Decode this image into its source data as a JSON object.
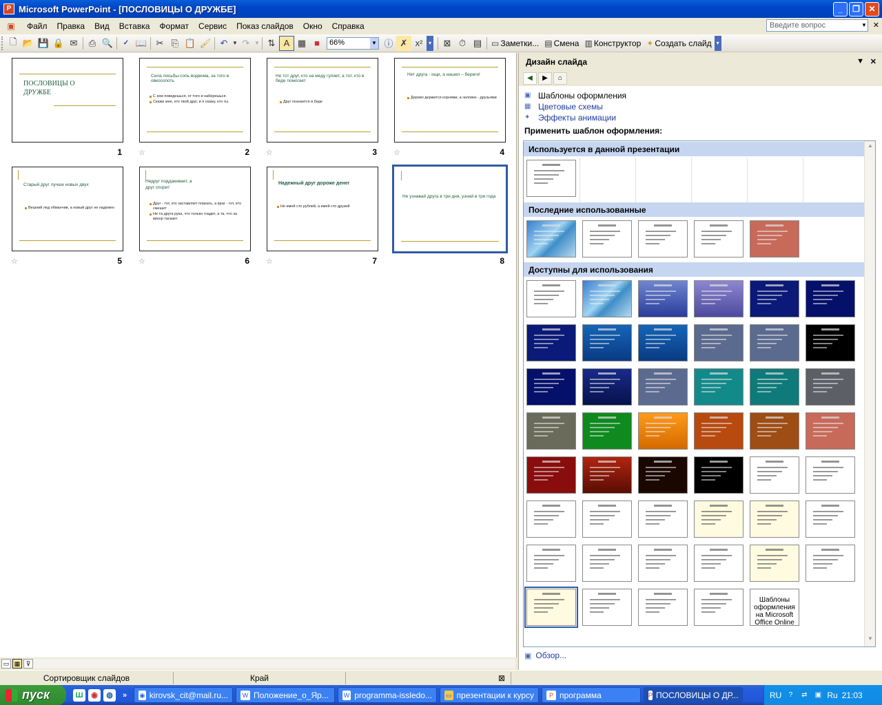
{
  "window": {
    "title": "Microsoft PowerPoint - [ПОСЛОВИЦЫ О ДРУЖБЕ]"
  },
  "menu": [
    "Файл",
    "Правка",
    "Вид",
    "Вставка",
    "Формат",
    "Сервис",
    "Показ слайдов",
    "Окно",
    "Справка"
  ],
  "ask": {
    "placeholder": "Введите вопрос"
  },
  "toolbar": {
    "zoom": "66%",
    "notes": "Заметки...",
    "transition": "Смена",
    "designer": "Конструктор",
    "new_slide": "Создать слайд"
  },
  "slides": [
    {
      "num": "1",
      "title": "ПОСЛОВИЦЫ О ДРУЖБЕ",
      "bullets": []
    },
    {
      "num": "2",
      "title": "Сила лисьбы-сопь водвома, за того в овкосопоть",
      "bullets": [
        "С кем поведешься, от того и наберешься.",
        "Скажи мне, кто твой друг, и я скажу, кто ты."
      ]
    },
    {
      "num": "3",
      "title": "Не тот друг, кто на меду гуляет, а тот, кто в беде помогает",
      "bullets": [
        "Друг познается в беде"
      ]
    },
    {
      "num": "4",
      "title": "Нет друга - ищи, а нашел – береги!",
      "bullets": [
        "Дерево держится корнями, а человек - друзьями"
      ]
    },
    {
      "num": "5",
      "title": "Старый друг лучше новых двух",
      "bullets": [
        "Вешний лед обманчив, а новый друг не надежен"
      ]
    },
    {
      "num": "6",
      "title": "Недруг поддакивает, а друг спорит",
      "bullets": [
        "Друг - тот, кто заставляет плакать, а враг - тот, кто смешит",
        "Не та друга рука, что только гладит, а та, что за вихор таскает"
      ]
    },
    {
      "num": "7",
      "title": "Надежный друг дороже денег",
      "bullets": [
        "Не имей сто рублей, а имей сто друзей"
      ]
    },
    {
      "num": "8",
      "title": "Не узнавай друга в три дня, узнай в три года",
      "bullets": []
    }
  ],
  "status": {
    "view": "Сортировщик слайдов",
    "template": "Край"
  },
  "taskpane": {
    "title": "Дизайн слайда",
    "links": [
      "Шаблоны оформления",
      "Цветовые схемы",
      "Эффекты анимации"
    ],
    "apply_label": "Применить шаблон оформления:",
    "sections": [
      "Используется в данной презентации",
      "Последние использованные",
      "Доступны для использования"
    ],
    "online_label": "Шаблоны оформления на Microsoft Office Online",
    "browse": "Обзор..."
  },
  "taskbar": {
    "start": "пуск",
    "items": [
      "kirovsk_cit@mail.ru...",
      "Положение_о_Яр...",
      "programma-issledo...",
      "презентации к курсу",
      "программа",
      "ПОСЛОВИЦЫ О ДР..."
    ],
    "lang": "RU",
    "lang2": "Ru",
    "clock": "21:03"
  },
  "colors": {
    "titlebar": "#0046c8",
    "taskpane_section": "#c6d6f0",
    "slide_accent": "#b8a030",
    "slide_title": "#1d5c3d"
  }
}
